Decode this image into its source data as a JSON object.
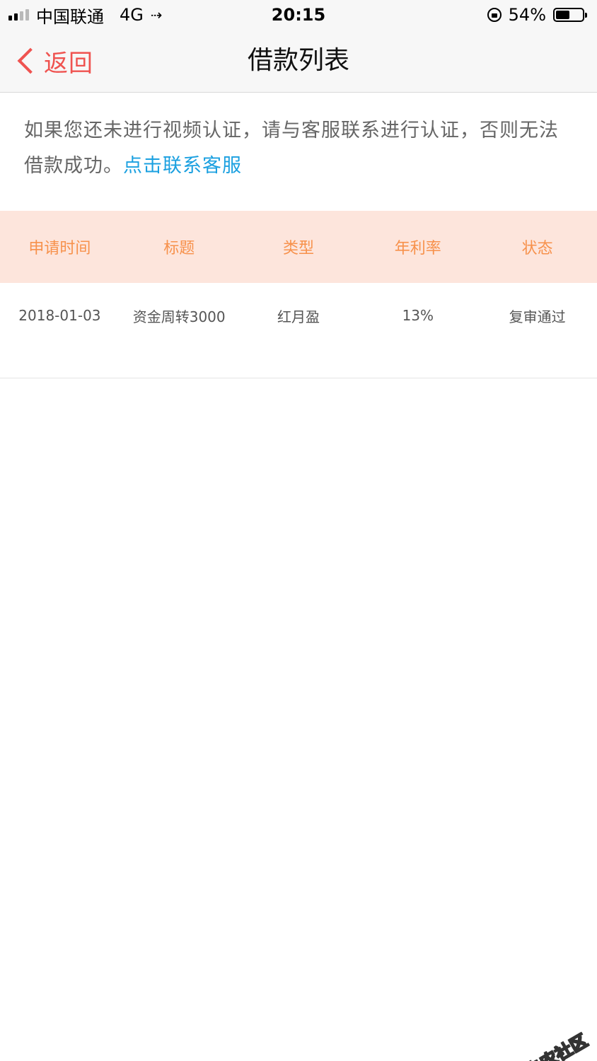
{
  "status_bar": {
    "carrier": "中国联通",
    "network": "4G",
    "time": "20:15",
    "battery_percent": "54%",
    "battery_level": 0.54
  },
  "nav": {
    "back_label": "返回",
    "title": "借款列表"
  },
  "notice": {
    "text": "如果您还未进行视频认证，请与客服联系进行认证，否则无法借款成功。",
    "link_text": "点击联系客服"
  },
  "table": {
    "headers": [
      "申请时间",
      "标题",
      "类型",
      "年利率",
      "状态"
    ],
    "rows": [
      [
        "2018-01-03",
        "资金周转3000",
        "红月盈",
        "13%",
        "复审通过"
      ]
    ]
  },
  "watermark": {
    "text": "卡农社区"
  },
  "colors": {
    "accent_red": "#ef5350",
    "link_blue": "#1ba0e0",
    "header_bg": "#fde5dc",
    "header_text": "#f7914b"
  }
}
